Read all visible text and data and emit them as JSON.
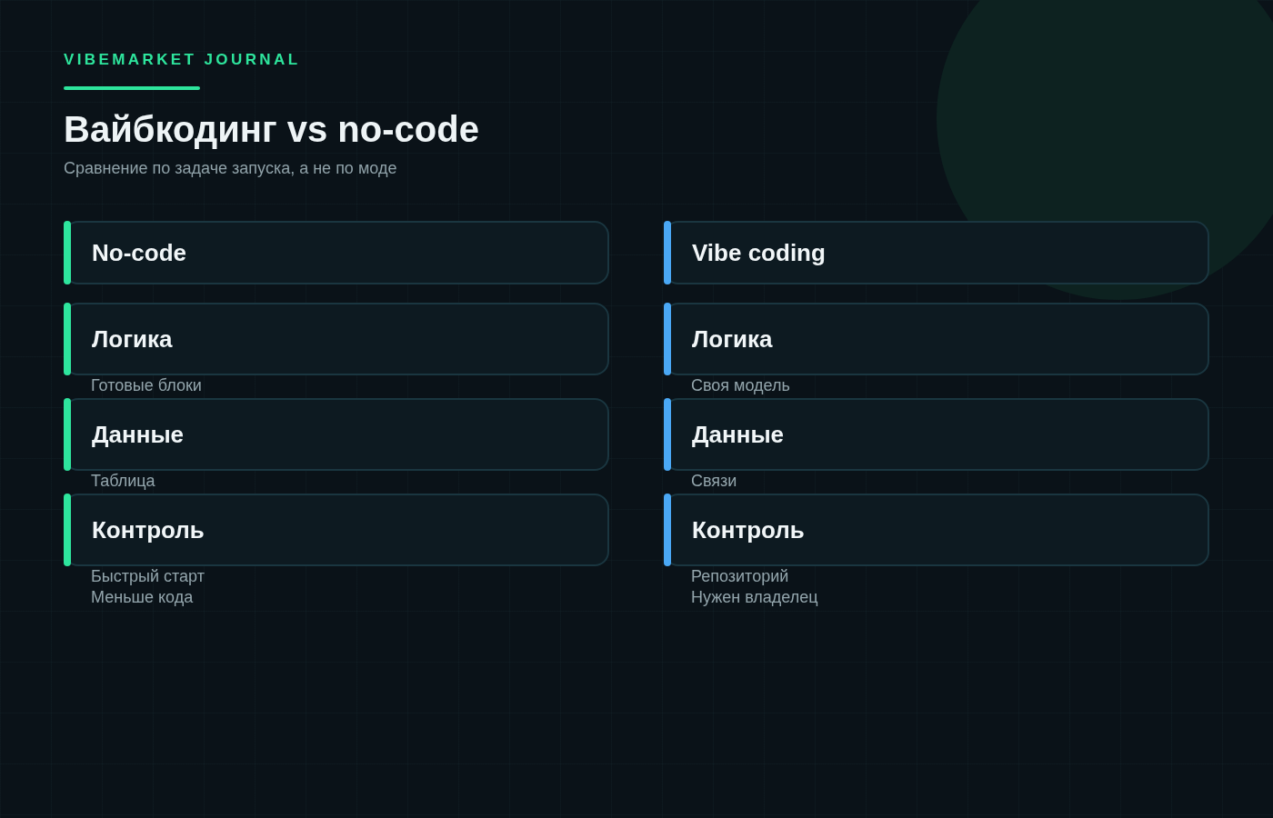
{
  "brand": "VIBEMARKET JOURNAL",
  "title": "Вайбкодинг vs no-code",
  "subtitle": "Сравнение по задаче запуска, а не по моде",
  "columns": [
    {
      "heading": "No-code",
      "color": "#2ee59d",
      "rows": [
        {
          "title": "Логика",
          "lines": [
            "Готовые блоки"
          ]
        },
        {
          "title": "Данные",
          "lines": [
            "Таблица"
          ]
        },
        {
          "title": "Контроль",
          "lines": [
            "Быстрый старт",
            "Меньше кода"
          ]
        }
      ]
    },
    {
      "heading": "Vibe coding",
      "color": "#4aa8f5",
      "rows": [
        {
          "title": "Логика",
          "lines": [
            "Своя модель"
          ]
        },
        {
          "title": "Данные",
          "lines": [
            "Связи"
          ]
        },
        {
          "title": "Контроль",
          "lines": [
            "Репозиторий",
            "Нужен владелец"
          ]
        }
      ]
    }
  ]
}
